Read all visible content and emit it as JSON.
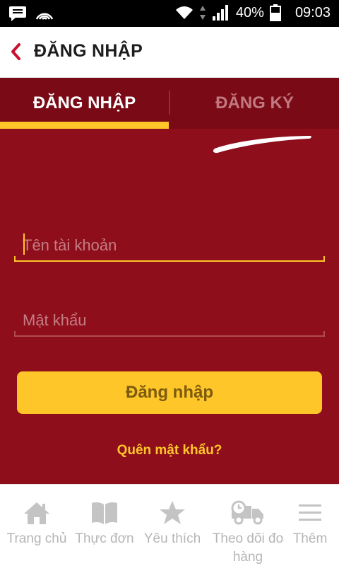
{
  "status_bar": {
    "battery": "40%",
    "time": "09:03",
    "icons": [
      "message-icon",
      "signal-arc-icon",
      "wifi-icon",
      "data-arrows-icon",
      "cell-signal-icon",
      "battery-icon"
    ]
  },
  "app_bar": {
    "back_icon": "chevron-left-icon",
    "title": "ĐĂNG NHẬP"
  },
  "tabs": [
    {
      "label": "ĐĂNG NHẬP",
      "active": true
    },
    {
      "label": "ĐĂNG KÝ",
      "active": false
    }
  ],
  "form": {
    "username": {
      "value": "",
      "placeholder": "Tên tài khoản"
    },
    "password": {
      "value": "",
      "placeholder": "Mật khẩu"
    },
    "submit_label": "Đăng nhập",
    "forgot_label": "Quên mật khẩu?"
  },
  "bottom_nav": [
    {
      "label": "Trang chủ",
      "icon": "home-icon"
    },
    {
      "label": "Thực đơn",
      "icon": "book-icon"
    },
    {
      "label": "Yêu thích",
      "icon": "star-icon"
    },
    {
      "label": "Theo dõi đo hàng",
      "icon": "delivery-truck-icon"
    },
    {
      "label": "Thêm",
      "icon": "menu-icon"
    }
  ],
  "colors": {
    "brand_red": "#8e0e1c",
    "tab_bar": "#7a0b16",
    "accent_yellow": "#ffc629",
    "back_red": "#c8102e",
    "nav_gray": "#b5b5b5"
  }
}
